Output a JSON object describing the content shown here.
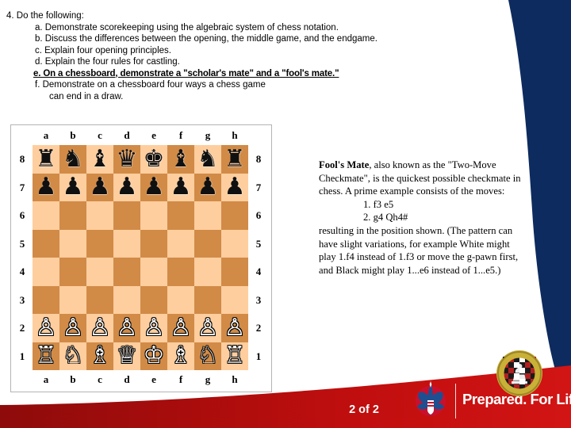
{
  "requirement": {
    "heading": "4. Do the following:",
    "items": [
      {
        "label": "a. Demonstrate scorekeeping using the algebraic system of chess notation.",
        "highlight": false
      },
      {
        "label": "b. Discuss the differences between the opening, the middle game, and the endgame.",
        "highlight": false
      },
      {
        "label": "c. Explain four opening principles.",
        "highlight": false
      },
      {
        "label": "d. Explain the four rules for castling.",
        "highlight": false
      },
      {
        "label": "e. On a chessboard, demonstrate a \"scholar's mate\" and a \"fool's mate.\"",
        "highlight": true
      },
      {
        "label": "f. Demonstrate on a chessboard four ways a chess game",
        "highlight": false
      }
    ],
    "continuation": "can end in a draw."
  },
  "board": {
    "files": [
      "a",
      "b",
      "c",
      "d",
      "e",
      "f",
      "g",
      "h"
    ],
    "ranks": [
      "8",
      "7",
      "6",
      "5",
      "4",
      "3",
      "2",
      "1"
    ],
    "light_color": "#FFCE9E",
    "dark_color": "#D18B47",
    "first_square_light": true,
    "pieces": [
      [
        "r",
        "n",
        "b",
        "q",
        "k",
        "b",
        "n",
        "r"
      ],
      [
        "p",
        "p",
        "p",
        "p",
        "p",
        "p",
        "p",
        "p"
      ],
      [
        "",
        "",
        "",
        "",
        "",
        "",
        "",
        ""
      ],
      [
        "",
        "",
        "",
        "",
        "",
        "",
        "",
        ""
      ],
      [
        "",
        "",
        "",
        "",
        "",
        "",
        "",
        ""
      ],
      [
        "",
        "",
        "",
        "",
        "",
        "",
        "",
        ""
      ],
      [
        "P",
        "P",
        "P",
        "P",
        "P",
        "P",
        "P",
        "P"
      ],
      [
        "R",
        "N",
        "B",
        "Q",
        "K",
        "B",
        "N",
        "R"
      ]
    ],
    "glyphs": {
      "K": "♔",
      "Q": "♕",
      "R": "♖",
      "B": "♗",
      "N": "♘",
      "P": "♙",
      "k": "♚",
      "q": "♛",
      "r": "♜",
      "b": "♝",
      "n": "♞",
      "p": "♟"
    }
  },
  "description": {
    "title": "Fool's Mate",
    "intro": ", also known as the \"Two-Move Checkmate\", is the quickest possible checkmate in chess. A prime example consists of the moves:",
    "moves": [
      "1. f3 e5",
      "2. g4 Qh4#"
    ],
    "outro": "resulting in the position shown. (The pattern can have slight variations, for example White might play 1.f4 instead of 1.f3 or move the g-pawn first, and Black might play 1...e6 instead of 1...e5.)"
  },
  "footer": {
    "tagline": "Prepared. For Life.",
    "trademark": "™",
    "page_number": "2 of 2",
    "navy_color": "#0D2B5E",
    "red_color": "#CC0000",
    "red_dark_color": "#8E0B0B"
  }
}
